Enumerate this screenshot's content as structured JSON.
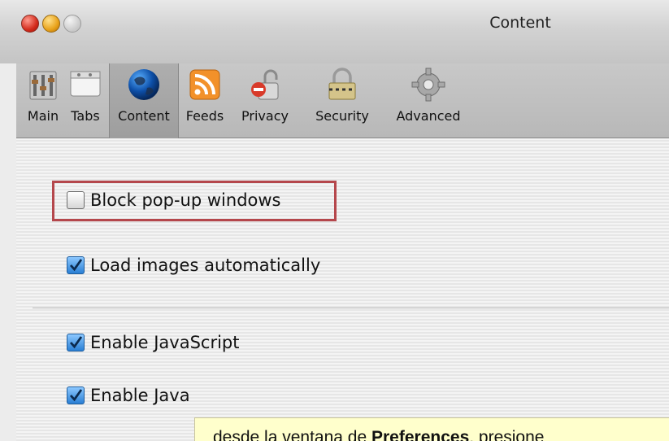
{
  "window": {
    "title": "Content"
  },
  "toolbar": {
    "items": [
      {
        "label": "Main",
        "icon": "main-prefs-icon"
      },
      {
        "label": "Tabs",
        "icon": "tabs-icon"
      },
      {
        "label": "Content",
        "icon": "globe-icon",
        "selected": true
      },
      {
        "label": "Feeds",
        "icon": "rss-feed-icon"
      },
      {
        "label": "Privacy",
        "icon": "privacy-lock-icon"
      },
      {
        "label": "Security",
        "icon": "security-padlock-icon"
      },
      {
        "label": "Advanced",
        "icon": "gear-icon"
      }
    ]
  },
  "options": {
    "block_popups": {
      "label": "Block pop-up windows",
      "checked": false
    },
    "load_images": {
      "label": "Load images automatically",
      "checked": true
    },
    "enable_js": {
      "label": "Enable JavaScript",
      "checked": true
    },
    "enable_java": {
      "label": "Enable Java",
      "checked": true
    }
  },
  "caption": {
    "before": "desde la ventana de ",
    "bold": "Preferences",
    "after": ", presione"
  },
  "colors": {
    "highlight_border": "#b5474c",
    "caption_background": "#ffffcc",
    "checkbox_checked": "#2a7fd4"
  }
}
